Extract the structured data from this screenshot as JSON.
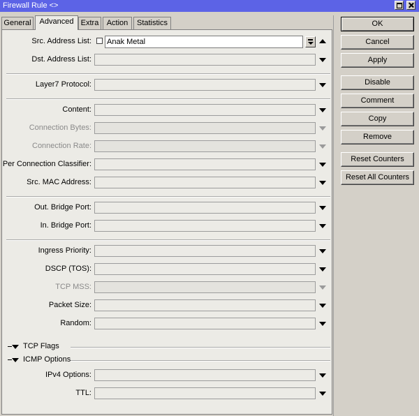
{
  "window": {
    "title": "Firewall Rule <>"
  },
  "tabs": [
    "General",
    "Advanced",
    "Extra",
    "Action",
    "Statistics"
  ],
  "fields": {
    "src_address_list": {
      "label": "Src. Address List:",
      "value": "Anak Metal"
    },
    "dst_address_list": {
      "label": "Dst. Address List:"
    },
    "layer7_protocol": {
      "label": "Layer7 Protocol:"
    },
    "content": {
      "label": "Content:"
    },
    "connection_bytes": {
      "label": "Connection Bytes:"
    },
    "connection_rate": {
      "label": "Connection Rate:"
    },
    "per_connection_classifier": {
      "label": "Per Connection Classifier:"
    },
    "src_mac_address": {
      "label": "Src. MAC Address:"
    },
    "out_bridge_port": {
      "label": "Out. Bridge Port:"
    },
    "in_bridge_port": {
      "label": "In. Bridge Port:"
    },
    "ingress_priority": {
      "label": "Ingress Priority:"
    },
    "dscp_tos": {
      "label": "DSCP (TOS):"
    },
    "tcp_mss": {
      "label": "TCP MSS:"
    },
    "packet_size": {
      "label": "Packet Size:"
    },
    "random": {
      "label": "Random:"
    },
    "ipv4_options": {
      "label": "IPv4 Options:"
    },
    "ttl": {
      "label": "TTL:"
    }
  },
  "sections": {
    "tcp_flags": "TCP Flags",
    "icmp_options": "ICMP Options"
  },
  "buttons": {
    "ok": "OK",
    "cancel": "Cancel",
    "apply": "Apply",
    "disable": "Disable",
    "comment": "Comment",
    "copy": "Copy",
    "remove": "Remove",
    "reset_counters": "Reset Counters",
    "reset_all_counters": "Reset All Counters"
  }
}
